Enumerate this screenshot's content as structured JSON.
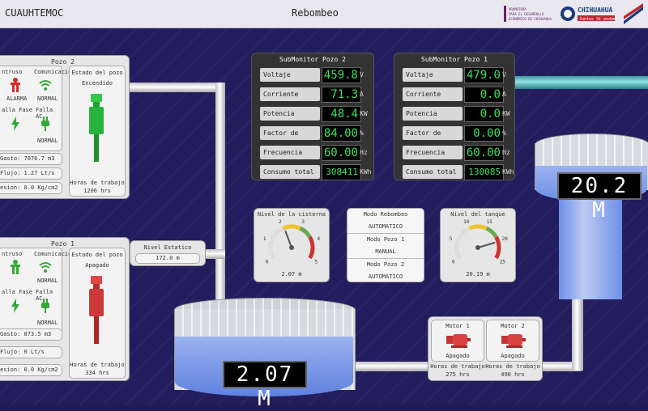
{
  "header": {
    "city": "CUAUHTEMOC",
    "title": "Rebombeo"
  },
  "pozo2": {
    "title": "Pozo 2",
    "intruso_label": "ntruso",
    "intruso_status": "ALARMA",
    "comunicacion_label": "Comunicación",
    "comunicacion_status": "NORMAL",
    "fallafase_label": "alla Fase",
    "fallaac_label": "Falla AC",
    "fallaac_status": "NORMAL",
    "gasto": "Gasto: 7076.7 m3",
    "flujo": "Flujo: 1.27 Lt/s",
    "presion": "esion: 0.0 Kg/cm2",
    "estado_label": "Estado del pozo",
    "estado_value": "Encendido",
    "horas_label": "Horas de trabajo",
    "horas_value": "1206 hrs"
  },
  "pozo1": {
    "title": "Pozo 1",
    "intruso_label": "ntruso",
    "comunicacion_label": "Comunicación",
    "comunicacion_status": "NORMAL",
    "fallafase_label": "alla Fase",
    "fallaac_label": "Falla AC",
    "fallaac_status": "NORMAL",
    "gasto": "Gasto: 873.5 m3",
    "flujo": "Flujo: 0 Lt/s",
    "presion": "esion: 0.0 Kg/cm2",
    "estado_label": "Estado del pozo",
    "estado_value": "Apagado",
    "horas_label": "Horas de trabajo",
    "horas_value": "334 hrs"
  },
  "nivel_estatico": {
    "label": "Nivel Estatico",
    "value": "172.0 m"
  },
  "submonitor2": {
    "title": "SubMonitor Pozo 2",
    "rows": [
      {
        "label": "Voltaje",
        "value": "459.8",
        "unit": "V"
      },
      {
        "label": "Corriente",
        "value": "71.3",
        "unit": "A"
      },
      {
        "label": "Potencia",
        "value": "48.4",
        "unit": "KW"
      },
      {
        "label": "Factor de potencia",
        "value": "84.00",
        "unit": "%"
      },
      {
        "label": "Frecuencia",
        "value": "60.00",
        "unit": "Hz"
      },
      {
        "label": "Consumo total",
        "value": "308411",
        "unit": "KWh"
      }
    ]
  },
  "submonitor1": {
    "title": "SubMonitor Pozo 1",
    "rows": [
      {
        "label": "Voltaje",
        "value": "479.0",
        "unit": "V"
      },
      {
        "label": "Corriente",
        "value": "0.0",
        "unit": "A"
      },
      {
        "label": "Potencia",
        "value": "0.0",
        "unit": "KW"
      },
      {
        "label": "Factor de potencia",
        "value": "0.00",
        "unit": "%"
      },
      {
        "label": "Frecuencia",
        "value": "60.00",
        "unit": "Hz"
      },
      {
        "label": "Consumo total",
        "value": "130085",
        "unit": "KWh"
      }
    ]
  },
  "gauge_cisterna": {
    "title": "Nivel de la cisterna",
    "value": "2.07 m",
    "level": 2.07,
    "min": 0,
    "max": 5,
    "ticks": [
      "0",
      "1",
      "2",
      "3",
      "4",
      "5"
    ]
  },
  "gauge_tanque": {
    "title": "Nivel del tanque",
    "value": "20.19 m",
    "level": 20.19,
    "min": 0,
    "max": 25,
    "ticks": [
      "0",
      "5",
      "10",
      "15",
      "20",
      "25"
    ]
  },
  "modo": {
    "title": "Modo Rebombeo",
    "value": "AUTOMATICO",
    "pozo1_label": "Modo Pozo 1",
    "pozo1_value": "MANUAL",
    "pozo2_label": "Modo Pozo 2",
    "pozo2_value": "AUTOMATICO"
  },
  "cisterna_display": "2.07 M",
  "tanque_display": "20.2 M",
  "motors": {
    "m1": {
      "title": "Motor 1",
      "status": "Apagado",
      "horas_label": "Horas de trabajo",
      "horas_value": "275 hrs"
    },
    "m2": {
      "title": "Motor 2",
      "status": "Apagado",
      "horas_label": "Horas de trabajo",
      "horas_value": "490 hrs"
    }
  },
  "logos": {
    "logo1": "PROMOTORA PARA EL DESARROLLO ECONOMICO DE CHIHUAHUA",
    "logo2": "CHIHUAHUA Juntos Sí podemos"
  },
  "colors": {
    "alarm": "#d42a2a",
    "normal": "#33aa33",
    "display_green": "#38e35a",
    "water": "#6f8fe6"
  }
}
